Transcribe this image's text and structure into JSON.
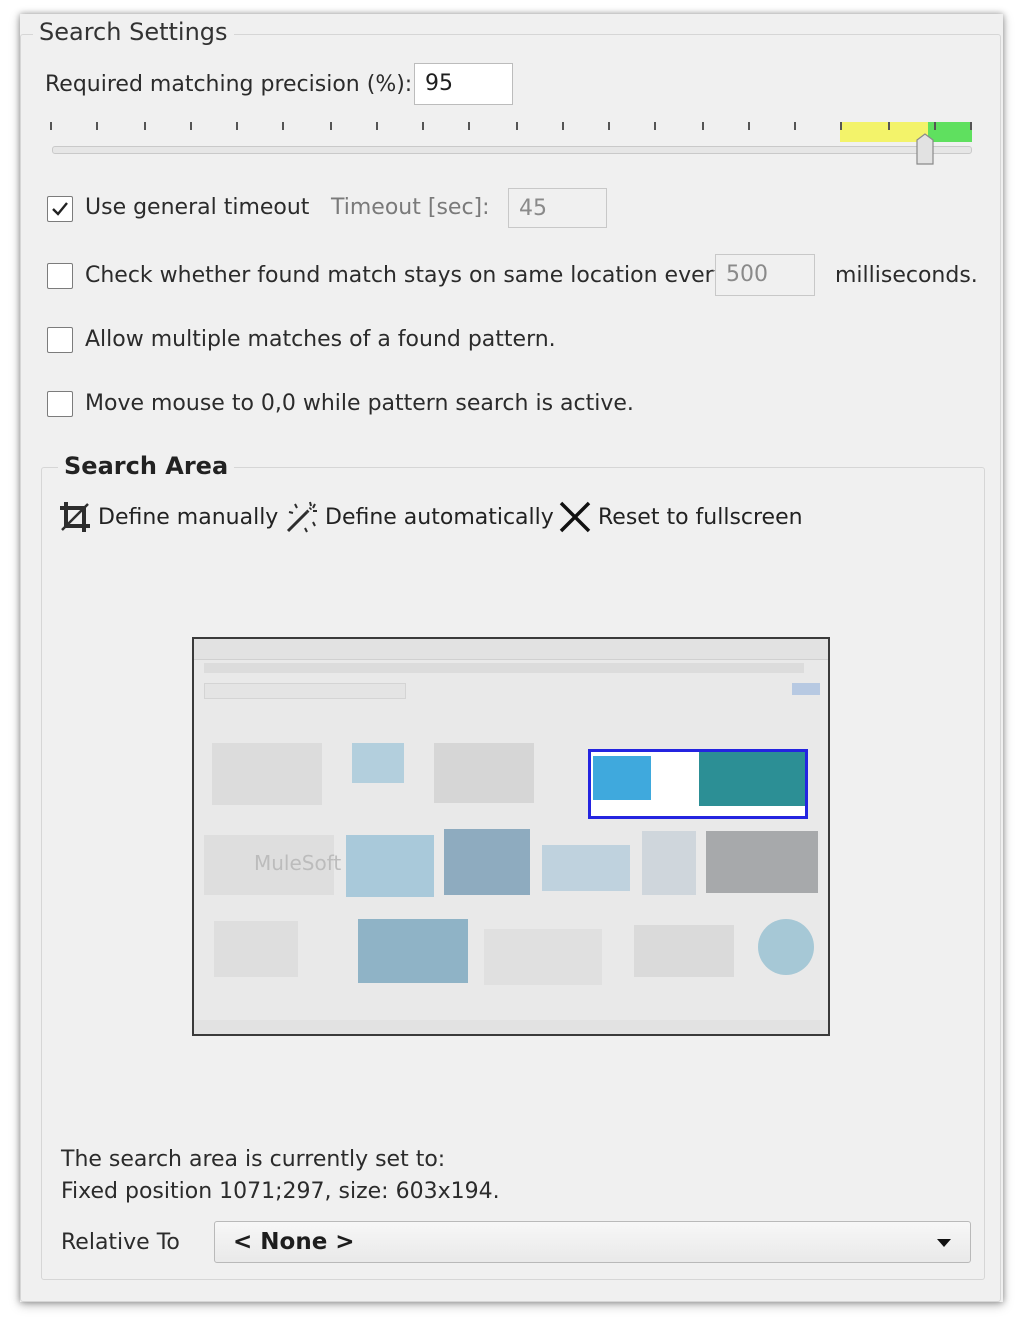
{
  "search_settings": {
    "title": "Search Settings",
    "precision_label": "Required matching precision (%):",
    "precision_value": "95",
    "slider_value_percent": 95,
    "use_timeout_label": "Use general timeout",
    "use_timeout_checked": true,
    "timeout_label": "Timeout [sec]:",
    "timeout_value": "45",
    "check_location_label": "Check whether found match stays on same location every",
    "check_location_ms": "500",
    "ms_label": "milliseconds.",
    "allow_multiple_label": "Allow multiple matches of a found pattern.",
    "move_mouse_label": "Move mouse to 0,0 while pattern search is active."
  },
  "search_area": {
    "title": "Search Area",
    "define_manually": "Define manually",
    "define_automatically": "Define automatically",
    "reset_fullscreen": "Reset to fullscreen",
    "current_label": "The search area is currently set to:",
    "current_value": "Fixed position 1071;297, size: 603x194.",
    "relative_to_label": "Relative To",
    "relative_to_value": "< None >",
    "preview_brand_text": "MuleSoft"
  },
  "colors": {
    "selection_box": "#2424e0",
    "slider_yellow": "#f3f36a",
    "slider_green": "#5fe05f"
  },
  "icons": [
    "crop-icon",
    "magic-wand-icon",
    "close-icon",
    "chevron-down-icon",
    "checkmark-icon"
  ]
}
